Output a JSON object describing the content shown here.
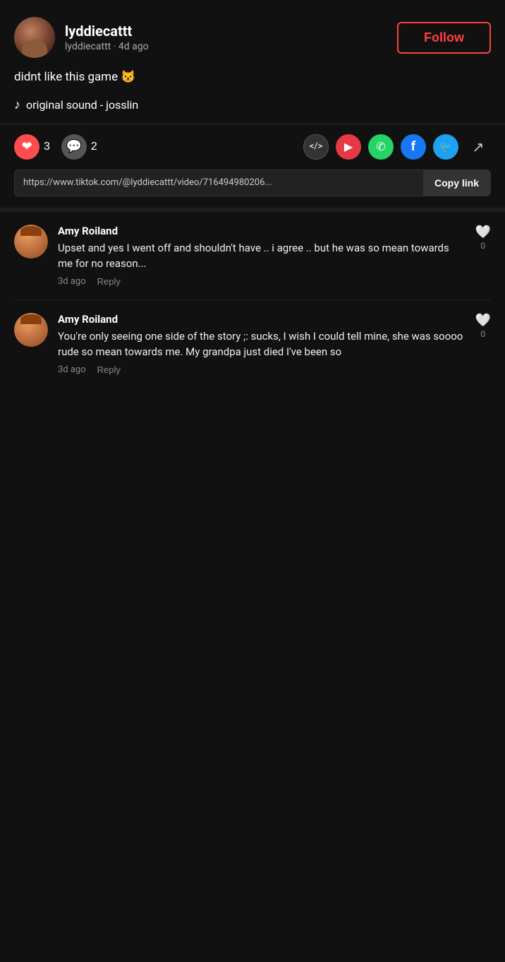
{
  "post": {
    "username": "lyddiecattt",
    "handle": "lyddiecattt",
    "time_ago": "4d ago",
    "caption": "didnt like this game 😾",
    "sound": "original sound - josslin",
    "likes": "3",
    "comments": "2",
    "link": "https://www.tiktok.com/@lyddiecattt/video/716494980206...",
    "copy_link_label": "Copy link",
    "follow_label": "Follow"
  },
  "share_icons": {
    "code": "&lt;/&gt;",
    "vimeo": "▶",
    "whatsapp": "✆",
    "facebook": "f",
    "twitter": "t",
    "more": "⇗"
  },
  "comments": [
    {
      "id": 1,
      "username": "Amy Roiland",
      "text": "Upset and yes I went off and shouldn't have .. i agree .. but he was so mean towards me for no reason...",
      "time_ago": "3d ago",
      "likes": "0",
      "reply_label": "Reply"
    },
    {
      "id": 2,
      "username": "Amy Roiland",
      "text": "You're only seeing one side of the story ;: sucks, I wish I could tell mine, she was soooo rude so mean towards me. My grandpa just died I've been so",
      "time_ago": "3d ago",
      "likes": "0",
      "reply_label": "Reply"
    }
  ]
}
